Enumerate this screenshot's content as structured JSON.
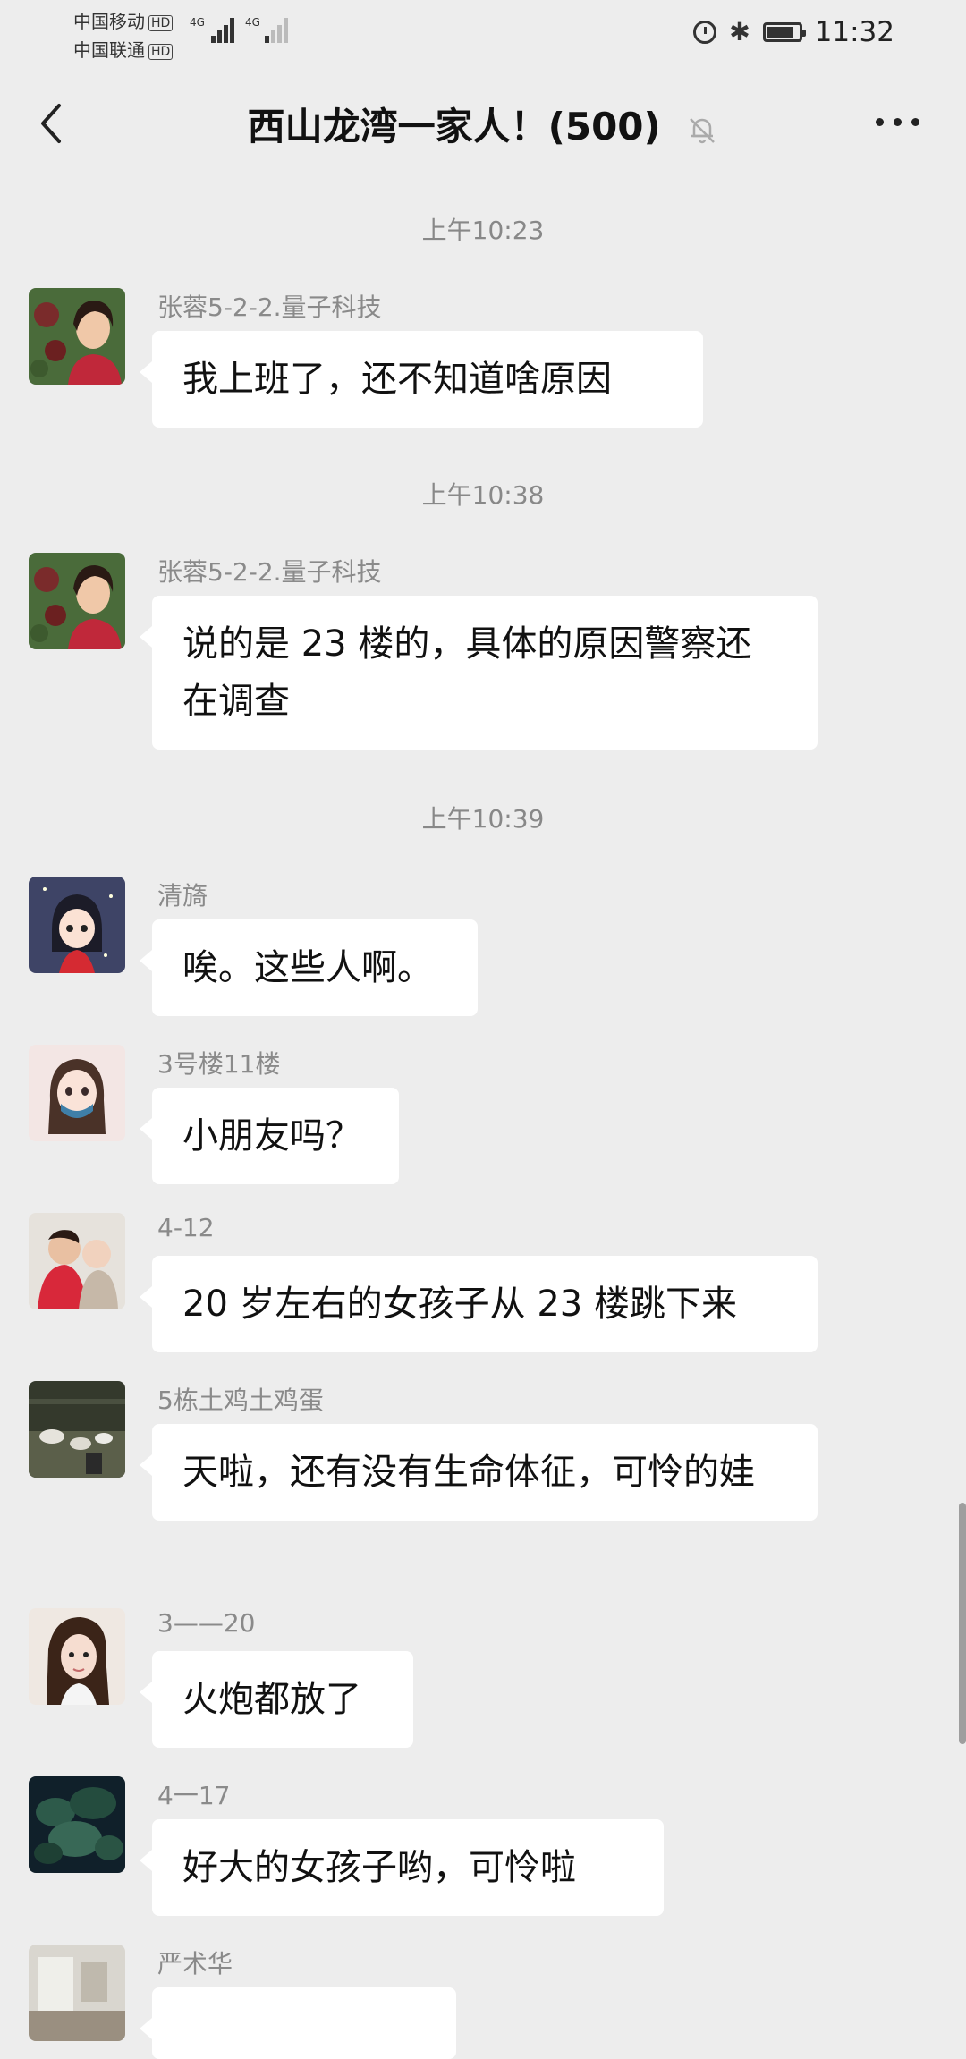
{
  "status": {
    "carrier1": "中国移动",
    "carrier2": "中国联通",
    "hd": "HD",
    "net1": "4G",
    "net2": "4G",
    "battery_level": 0.85,
    "time": "11:32"
  },
  "nav": {
    "back_icon": "chevron-left-icon",
    "title": "西山龙湾一家人！(500)",
    "mute_icon": "bell-muted-icon",
    "more_icon": "more-horizontal-icon"
  },
  "chat": {
    "timestamps": [
      "上午10:23",
      "上午10:38",
      "上午10:39"
    ],
    "messages": [
      {
        "sender": "张蓉5-2-2.量子科技",
        "text": "我上班了，还不知道啥原因",
        "avatar": "photo-woman-red-flowers"
      },
      {
        "sender": "张蓉5-2-2.量子科技",
        "text": "说的是 23 楼的，具体的原因警察还在调查",
        "avatar": "photo-woman-red-flowers"
      },
      {
        "sender": "清旖",
        "text": "唉。这些人啊。",
        "avatar": "cartoon-girl-avatar"
      },
      {
        "sender": "3号楼11楼",
        "text": "小朋友吗？",
        "avatar": "cartoon-girl-mask-avatar"
      },
      {
        "sender": "4-12",
        "text": "20 岁左右的女孩子从 23 楼跳下来",
        "avatar": "photo-children"
      },
      {
        "sender": "5栋土鸡土鸡蛋",
        "text": "天啦，还有没有生命体征，可怜的娃",
        "avatar": "photo-chickens"
      },
      {
        "sender": "3——20",
        "text": "火炮都放了",
        "avatar": "photo-woman-portrait"
      },
      {
        "sender": "4一17",
        "text": "好大的女孩子哟，可怜啦",
        "avatar": "photo-dark-plants"
      },
      {
        "sender": "严术华",
        "text": "",
        "avatar": "photo-room"
      }
    ]
  },
  "colors": {
    "background": "#ededed",
    "bubble": "#ffffff",
    "timestamp_text": "#888888",
    "sender_text": "#8a8a8a"
  }
}
